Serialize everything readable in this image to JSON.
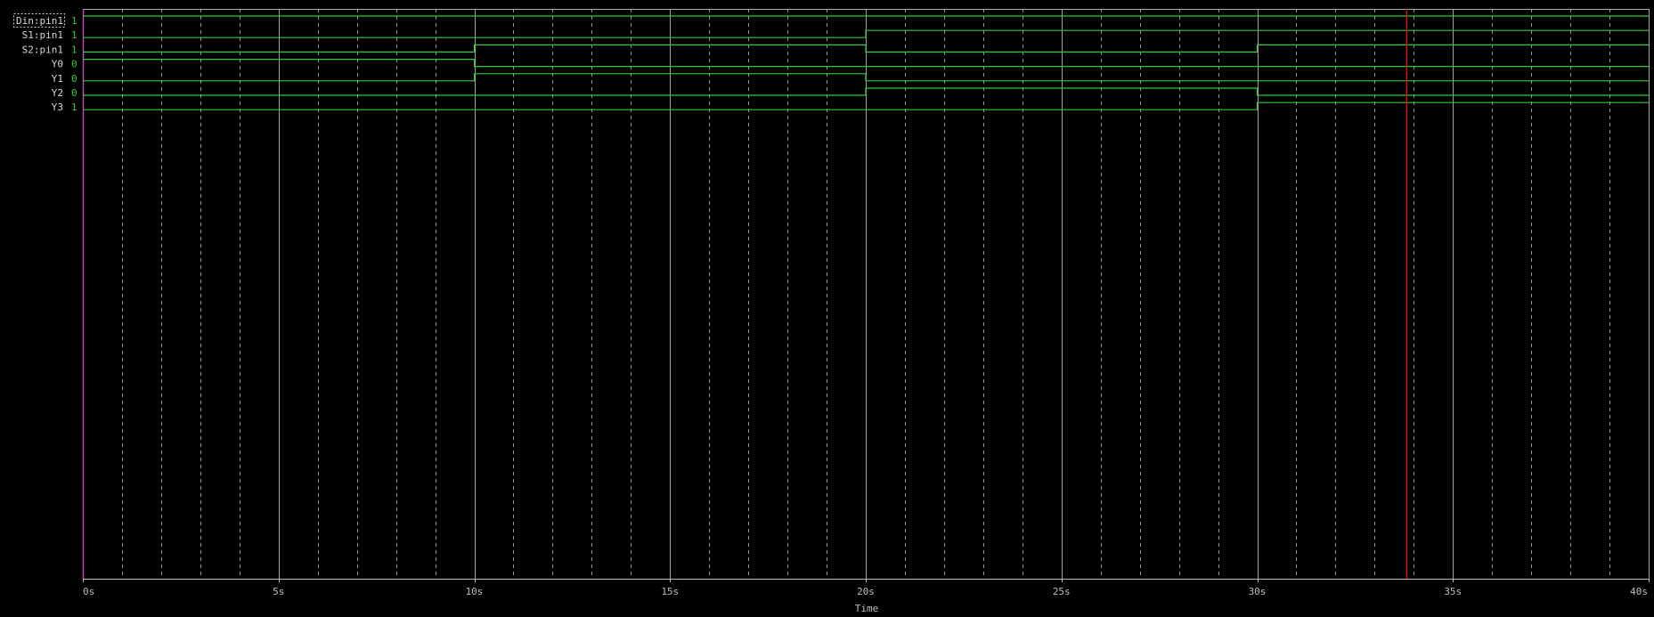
{
  "colors": {
    "background": "#000000",
    "trace": "#33cc33",
    "grid_major": "#b4b4b4",
    "grid_minor": "#cfcfcf",
    "axis": "#c0c0c0",
    "left_axis": "#c044c0",
    "cursor": "#e01010",
    "label_text": "#d8d8d8",
    "value_text": "#33cc33"
  },
  "chart_data": {
    "type": "line",
    "subtype": "digital-waveform",
    "title": "",
    "xlabel": "Time",
    "ylabel": "",
    "xlim": [
      0,
      40
    ],
    "x_unit": "s",
    "x_major_step": 5,
    "x_minor_step": 1,
    "x_ticks": [
      "0s",
      "5s",
      "10s",
      "15s",
      "20s",
      "25s",
      "30s",
      "35s",
      "40s"
    ],
    "grid": true,
    "cursor_time": 33.8,
    "selected_signal": "Din:pin1",
    "transitions": [
      0,
      10,
      20,
      30
    ],
    "signals": [
      {
        "name": "Din:pin1",
        "value": "1",
        "levels": [
          1,
          1,
          1,
          1
        ]
      },
      {
        "name": "S1:pin1",
        "value": "1",
        "levels": [
          0,
          0,
          1,
          1
        ]
      },
      {
        "name": "S2:pin1",
        "value": "1",
        "levels": [
          0,
          1,
          0,
          1
        ]
      },
      {
        "name": "Y0",
        "value": "0",
        "levels": [
          1,
          0,
          0,
          0
        ]
      },
      {
        "name": "Y1",
        "value": "0",
        "levels": [
          0,
          1,
          0,
          0
        ]
      },
      {
        "name": "Y2",
        "value": "0",
        "levels": [
          0,
          0,
          1,
          0
        ]
      },
      {
        "name": "Y3",
        "value": "1",
        "levels": [
          0,
          0,
          0,
          1
        ]
      }
    ]
  }
}
